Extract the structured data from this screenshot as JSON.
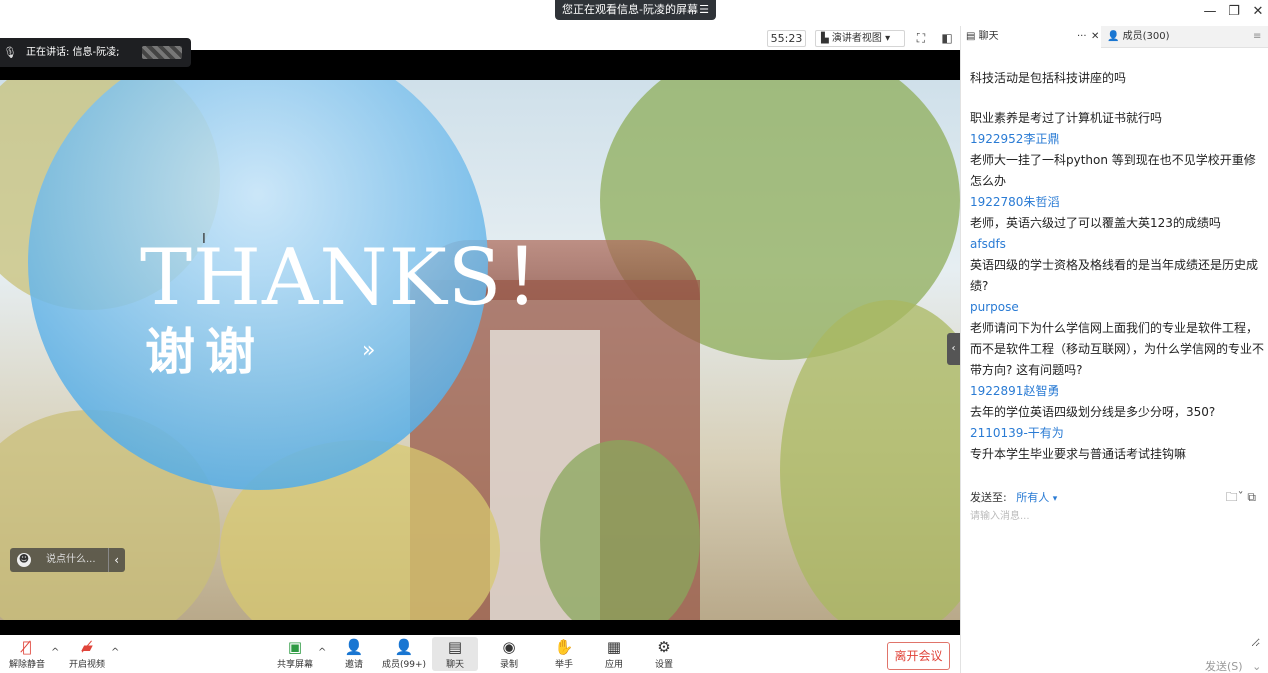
{
  "window": {
    "share_banner": "您正在观看信息-阮凌的屏幕",
    "banner_menu_icon": "menu-icon",
    "minimize": "—",
    "restore": "❐",
    "close": "✕"
  },
  "toolbar": {
    "timer": "55:23",
    "view_mode": "演讲者视图",
    "view_caret": "▾"
  },
  "speaker": {
    "label": "正在讲话: 信息-阮凌;"
  },
  "slide": {
    "title_en": "THANKS！",
    "title_cn": "谢谢",
    "arrows": "»"
  },
  "reaction": {
    "placeholder": "说点什么..."
  },
  "bottom": {
    "unmute": "解除静音",
    "start_video": "开启视频",
    "share_screen": "共享屏幕",
    "invite": "邀请",
    "members": "成员(99+)",
    "chat": "聊天",
    "record": "录制",
    "raise_hand": "举手",
    "apps": "应用",
    "settings": "设置",
    "leave": "离开会议"
  },
  "panel": {
    "chat_tab": "聊天",
    "chat_more": "···",
    "chat_close": "✕",
    "members_tab": "成员(300)",
    "menu": "≡"
  },
  "chat": {
    "messages": [
      {
        "sender": "",
        "text": "科技活动是包括科技讲座的吗"
      },
      {
        "sender": "",
        "text": "职业素养是考过了计算机证书就行吗"
      },
      {
        "sender": "1922952李正鼎",
        "text": "老师大一挂了一科python 等到现在也不见学校开重修怎么办"
      },
      {
        "sender": "1922780朱哲滔",
        "text": "老师，英语六级过了可以覆盖大英123的成绩吗"
      },
      {
        "sender": "afsdfs",
        "text": "英语四级的学士资格及格线看的是当年成绩还是历史成绩?"
      },
      {
        "sender": "purpose",
        "text": "老师请问下为什么学信网上面我们的专业是软件工程，而不是软件工程（移动互联网），为什么学信网的专业不带方向? 这有问题吗?"
      },
      {
        "sender": "1922891赵智勇",
        "text": "去年的学位英语四级划分线是多少分呀，350?"
      },
      {
        "sender": "2110139-干有为",
        "text": "专升本学生毕业要求与普通话考试挂钩嘛"
      }
    ],
    "send_to_label": "发送至:",
    "send_to_value": "所有人",
    "input_placeholder": "请输入消息...",
    "send_button": "发送(S)"
  }
}
